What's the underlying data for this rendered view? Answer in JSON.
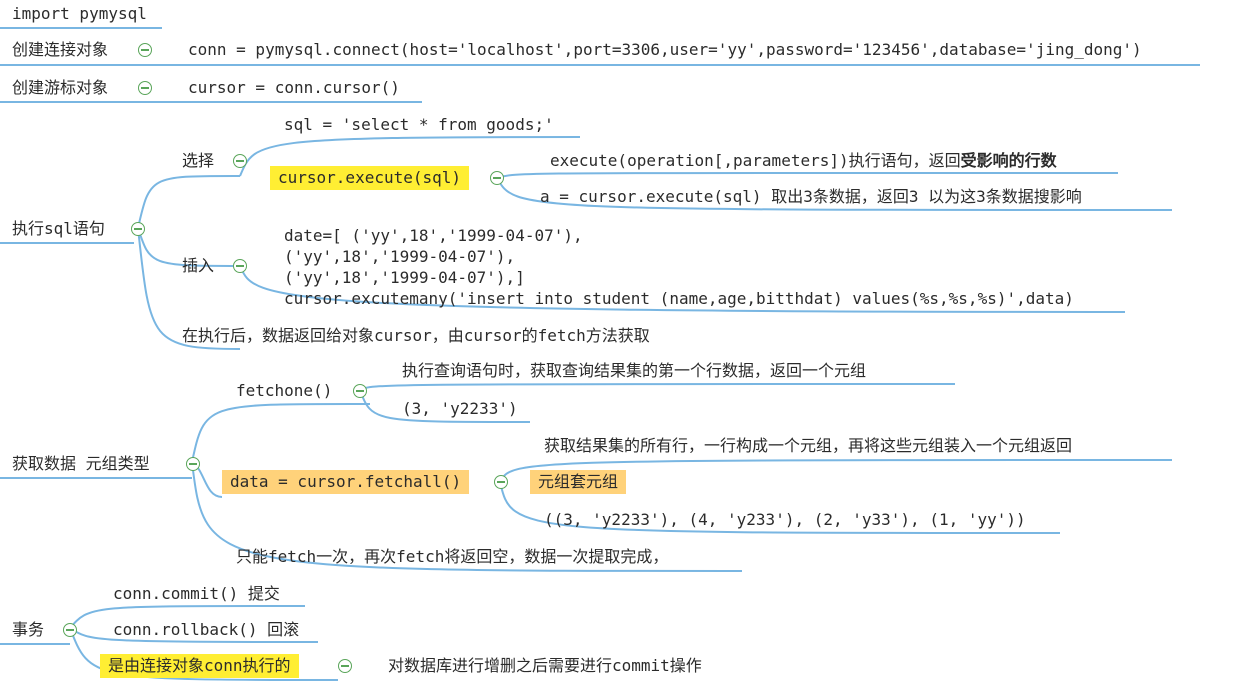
{
  "nodes": {
    "import": "import pymysql",
    "conn_label": "创建连接对象",
    "conn_code": "conn = pymysql.connect(host='localhost',port=3306,user='yy',password='123456',database='jing_dong')",
    "cursor_label": "创建游标对象",
    "cursor_code": "cursor = conn.cursor()",
    "exec_label": "执行sql语句",
    "select_label": "选择",
    "sql_code": "sql = 'select * from goods;'",
    "execute_code": "cursor.execute(sql)",
    "execute_desc_prefix": "execute(operation[,parameters])执行语句，返回",
    "execute_desc_bold": "受影响的行数",
    "execute_example": "a = cursor.execute(sql)    取出3条数据，返回3 以为这3条数据搜影响",
    "insert_label": "插入",
    "insert_code": "date=[ ('yy',18','1999-04-07'),\n('yy',18','1999-04-07'),\n('yy',18','1999-04-07'),]\ncursor.excutemany('insert into student (name,age,bitthdat) values(%s,%s,%s)',data)",
    "after_exec": "在执行后，数据返回给对象cursor，由cursor的fetch方法获取",
    "fetch_label": "获取数据 元组类型",
    "fetchone_code": "fetchone()",
    "fetchone_desc": "执行查询语句时，获取查询结果集的第一个行数据，返回一个元组",
    "fetchone_example": "(3, 'y2233')",
    "fetchall_code": "data = cursor.fetchall()",
    "fetchall_desc": "获取结果集的所有行，一行构成一个元组，再将这些元组装入一个元组返回",
    "tuple_nest": "元组套元组",
    "fetchall_example": "((3, 'y2233'), (4, 'y233'), (2, 'y33'), (1, 'yy'))",
    "fetch_once": "只能fetch一次，再次fetch将返回空，数据一次提取完成，",
    "tx_label": "事务",
    "commit": "conn.commit() 提交",
    "rollback": "conn.rollback() 回滚",
    "tx_conn": "是由连接对象conn执行的",
    "tx_desc": "对数据库进行增删之后需要进行commit操作"
  },
  "colors": {
    "link": "#79b6e2",
    "collapse": "#5aa55a",
    "highlight_yellow": "#ffee33",
    "highlight_orange": "#ffd27a"
  }
}
